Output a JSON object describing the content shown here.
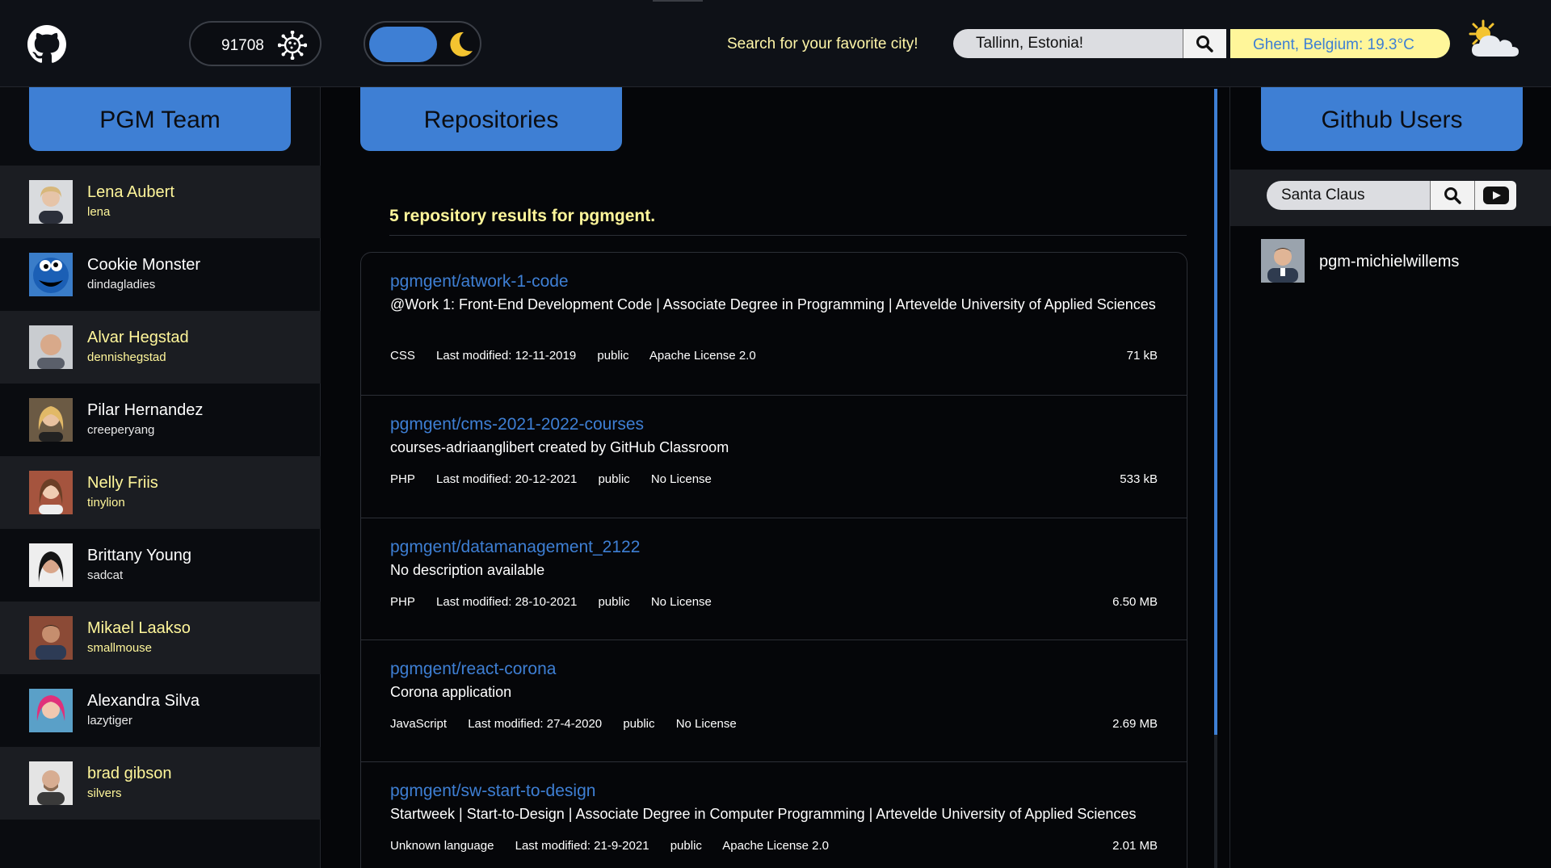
{
  "header": {
    "counter_value": "91708",
    "counter_icon": "virus-icon",
    "theme_icon": "moon-icon",
    "search_label": "Search for your favorite city!",
    "city_input_value": "Tallinn, Estonia!",
    "weather_text": "Ghent, Belgium:  19.3°C",
    "weather_icon": "partly-cloudy-icon"
  },
  "colors": {
    "accent": "#3e7fd4",
    "highlight": "#fff69a",
    "background": "#050609",
    "panel": "#0e1117"
  },
  "team": {
    "title": "PGM Team",
    "members": [
      {
        "name": "Lena Aubert",
        "username": "lena",
        "highlight": true
      },
      {
        "name": "Cookie Monster",
        "username": "dindagladies",
        "highlight": false
      },
      {
        "name": "Alvar Hegstad",
        "username": "dennishegstad",
        "highlight": true
      },
      {
        "name": "Pilar Hernandez",
        "username": "creeperyang",
        "highlight": false
      },
      {
        "name": "Nelly Friis",
        "username": "tinylion",
        "highlight": true
      },
      {
        "name": "Brittany Young",
        "username": "sadcat",
        "highlight": false
      },
      {
        "name": "Mikael Laakso",
        "username": "smallmouse",
        "highlight": true
      },
      {
        "name": "Alexandra Silva",
        "username": "lazytiger",
        "highlight": false
      },
      {
        "name": "brad gibson",
        "username": "silvers",
        "highlight": true
      }
    ]
  },
  "repositories": {
    "title": "Repositories",
    "results_text": "5 repository results for pgmgent.",
    "items": [
      {
        "name": "pgmgent/atwork-1-code",
        "description": "@Work 1: Front-End Development Code | Associate Degree in Programming | Artevelde University of Applied Sciences",
        "language": "CSS",
        "modified": "Last modified: 12-11-2019",
        "visibility": "public",
        "license": "Apache License 2.0",
        "size": "71 kB"
      },
      {
        "name": "pgmgent/cms-2021-2022-courses",
        "description": "courses-adriaanglibert created by GitHub Classroom",
        "language": "PHP",
        "modified": "Last modified: 20-12-2021",
        "visibility": "public",
        "license": "No License",
        "size": "533 kB"
      },
      {
        "name": "pgmgent/datamanagement_2122",
        "description": "No description available",
        "language": "PHP",
        "modified": "Last modified: 28-10-2021",
        "visibility": "public",
        "license": "No License",
        "size": "6.50 MB"
      },
      {
        "name": "pgmgent/react-corona",
        "description": "Corona application",
        "language": "JavaScript",
        "modified": "Last modified: 27-4-2020",
        "visibility": "public",
        "license": "No License",
        "size": "2.69 MB"
      },
      {
        "name": "pgmgent/sw-start-to-design",
        "description": "Startweek | Start-to-Design | Associate Degree in Computer Programming | Artevelde University of Applied Sciences",
        "language": "Unknown language",
        "modified": "Last modified: 21-9-2021",
        "visibility": "public",
        "license": "Apache License 2.0",
        "size": "2.01 MB"
      }
    ]
  },
  "github_users": {
    "title": "Github Users",
    "search_value": "Santa Claus",
    "results": [
      {
        "username": "pgm-michielwillems"
      }
    ]
  }
}
